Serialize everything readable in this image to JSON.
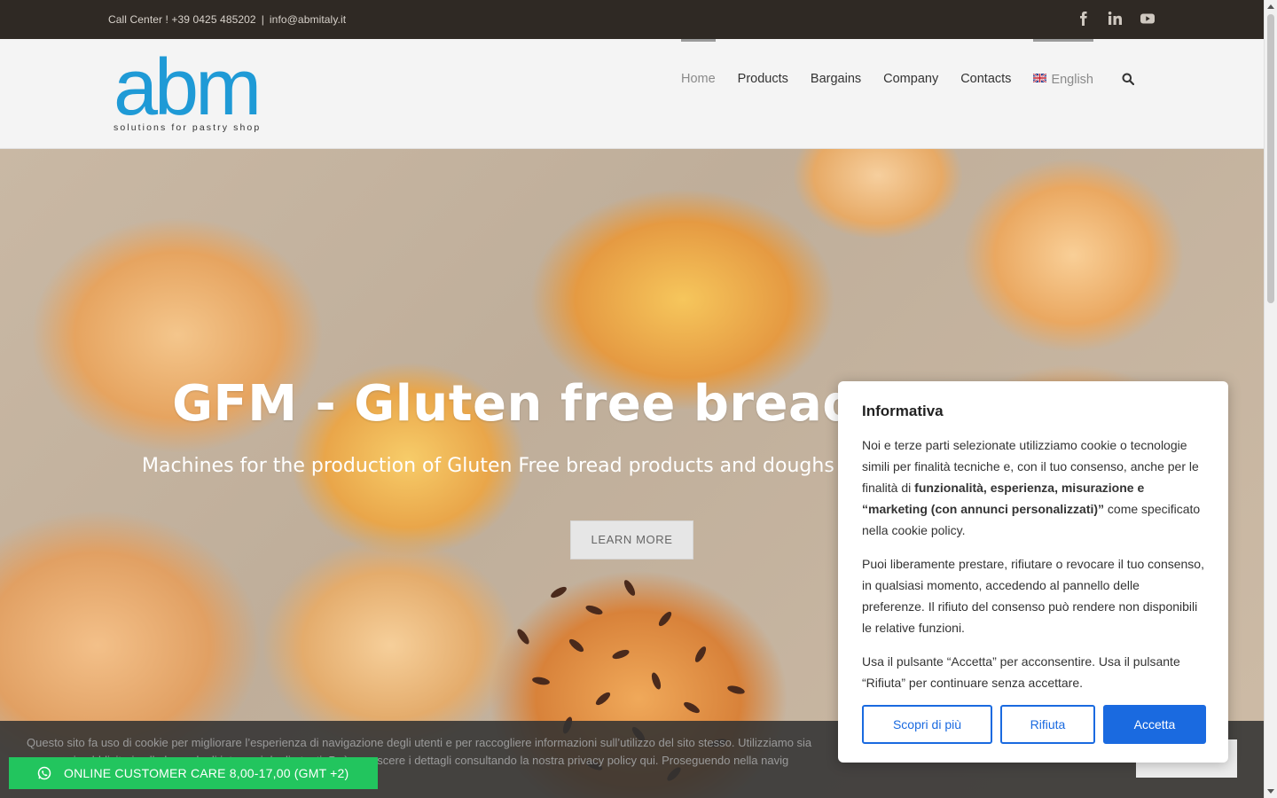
{
  "topbar": {
    "call_center": "Call Center ! +39 0425 485202",
    "separator": "|",
    "email": "info@abmitaly.it",
    "social": [
      "facebook-icon",
      "linkedin-icon",
      "youtube-icon"
    ]
  },
  "header": {
    "logo_word": "abm",
    "logo_tagline": "solutions for pastry shop",
    "nav": [
      "Home",
      "Products",
      "Bargains",
      "Company",
      "Contacts"
    ],
    "language": "English"
  },
  "hero": {
    "title": "GFM - Gluten free bread",
    "subtitle": "Machines for the production of Gluten Free bread products and doughs",
    "button": "LEARN MORE"
  },
  "cookie_bar": {
    "line1": "Questo sito fa uso di cookie per migliorare l’esperienza di navigazione degli utenti e per raccogliere informazioni sull’utilizzo del sito stesso. Utilizziamo sia",
    "line2": "messaggi pubblicitari sulla base degli interessi degli utenti. Può conoscere i dettagli consultando la nostra privacy policy qui. Proseguendo nella navig"
  },
  "customer_care": {
    "label": "ONLINE CUSTOMER CARE 8,00-17,00 (GMT +2)"
  },
  "consent": {
    "title": "Informativa",
    "p1_a": "Noi e terze parti selezionate utilizziamo cookie o tecnologie simili per finalità tecniche e, con il tuo consenso, anche per le finalità di ",
    "p1_bold": "funzionalità, esperienza, misurazione e “marketing (con annunci personalizzati)”",
    "p1_b": " come specificato nella cookie policy.",
    "p2": "Puoi liberamente prestare, rifiutare o revocare il tuo consenso, in qualsiasi momento, accedendo al pannello delle preferenze. Il rifiuto del consenso può rendere non disponibili le relative funzioni.",
    "p3": "Usa il pulsante “Accetta” per acconsentire. Usa il pulsante “Rifiuta” per continuare senza accettare.",
    "btn_more": "Scopri di più",
    "btn_reject": "Rifiuta",
    "btn_accept": "Accetta"
  },
  "colors": {
    "topbar_bg": "#2f2924",
    "logo_blue": "#1f9ad6",
    "consent_blue": "#1a6ae0",
    "whatsapp_green": "#22c55e"
  }
}
